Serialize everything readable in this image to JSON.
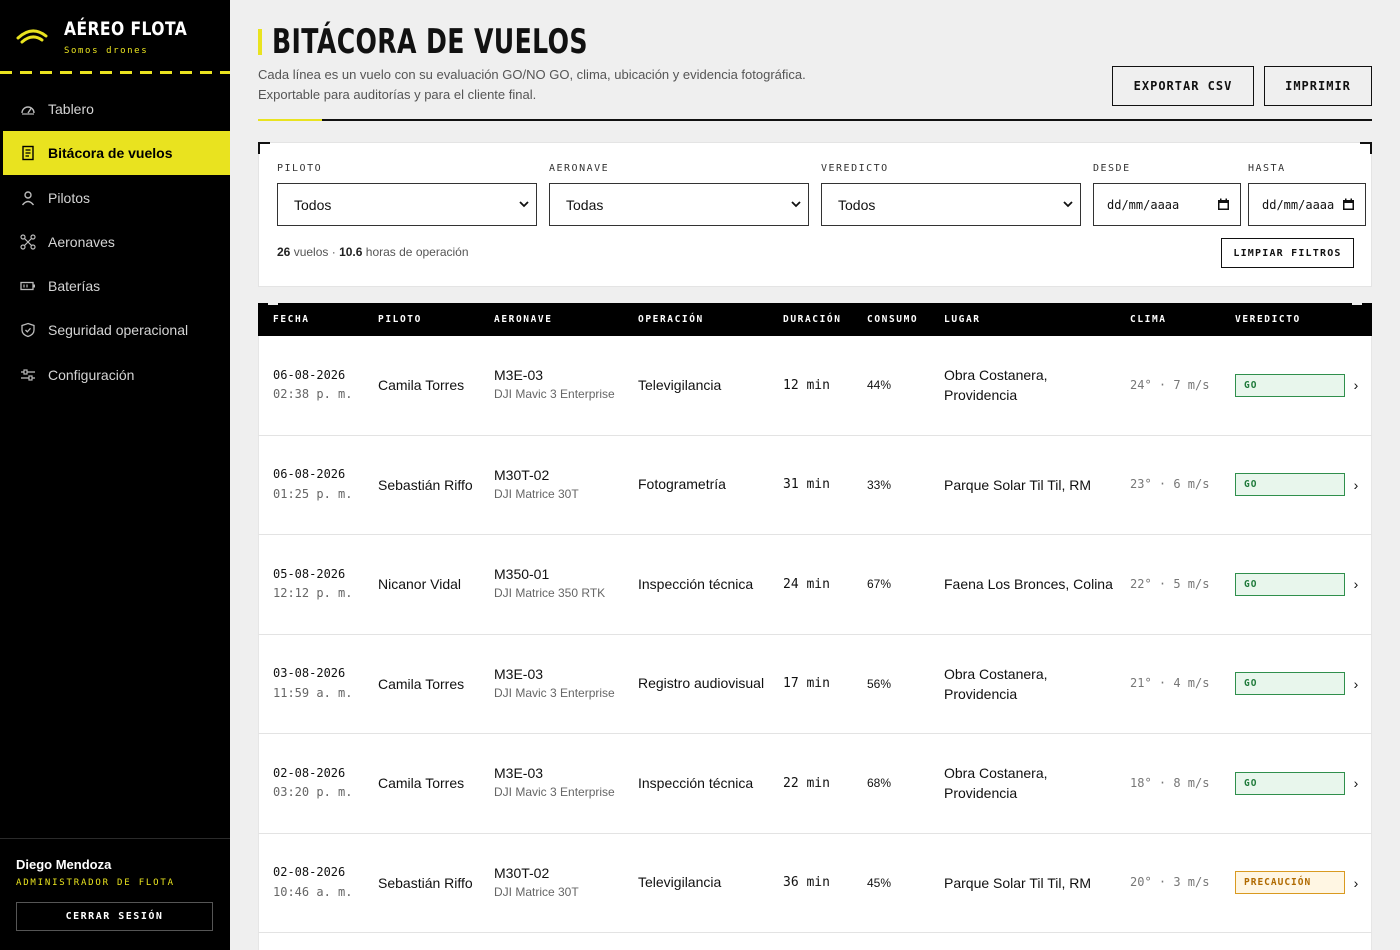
{
  "brand": {
    "name": "AÉREO FLOTA",
    "tagline": "Somos drones",
    "accent": "#e9e31f"
  },
  "nav": [
    {
      "label": "Tablero",
      "icon": "gauge-icon",
      "active": false
    },
    {
      "label": "Bitácora de vuelos",
      "icon": "document-icon",
      "active": true
    },
    {
      "label": "Pilotos",
      "icon": "user-icon",
      "active": false
    },
    {
      "label": "Aeronaves",
      "icon": "drone-icon",
      "active": false
    },
    {
      "label": "Baterías",
      "icon": "battery-icon",
      "active": false
    },
    {
      "label": "Seguridad operacional",
      "icon": "shield-icon",
      "active": false
    },
    {
      "label": "Configuración",
      "icon": "sliders-icon",
      "active": false
    }
  ],
  "user": {
    "name": "Diego Mendoza",
    "role": "ADMINISTRADOR DE FLOTA",
    "logout_label": "CERRAR SESIÓN"
  },
  "header": {
    "title": "BITÁCORA DE VUELOS",
    "subtitle_line1": "Cada línea es un vuelo con su evaluación GO/NO GO, clima, ubicación y evidencia fotográfica.",
    "subtitle_line2": "Exportable para auditorías y para el cliente final.",
    "export_label": "EXPORTAR CSV",
    "print_label": "IMPRIMIR"
  },
  "filters": {
    "pilot": {
      "label": "PILOTO",
      "value": "Todos"
    },
    "aircraft": {
      "label": "AERONAVE",
      "value": "Todas"
    },
    "verdict": {
      "label": "VEREDICTO",
      "value": "Todos"
    },
    "from": {
      "label": "DESDE",
      "value": "dd/mm/aaaa"
    },
    "to": {
      "label": "HASTA",
      "value": "dd/mm/aaaa"
    },
    "summary": {
      "flights": "26",
      "flights_suffix": "vuelos ·",
      "hours": "10.6",
      "hours_suffix": "horas de operación"
    },
    "clear_label": "LIMPIAR FILTROS"
  },
  "table": {
    "headers": {
      "date": "FECHA",
      "pilot": "PILOTO",
      "aircraft": "AERONAVE",
      "operation": "OPERACIÓN",
      "duration": "DURACIÓN",
      "consumption": "CONSUMO",
      "place": "LUGAR",
      "weather": "CLIMA",
      "verdict": "VEREDICTO"
    },
    "rows": [
      {
        "date": "06-08-2026",
        "time": "02:38 p. m.",
        "pilot": "Camila Torres",
        "code": "M3E-03",
        "model": "DJI Mavic 3 Enterprise",
        "operation": "Televigilancia",
        "duration": "12 min",
        "consumption": "44%",
        "place": "Obra Costanera, Providencia",
        "weather": "24° · 7 m/s",
        "verdict": "GO",
        "verdict_type": "go"
      },
      {
        "date": "06-08-2026",
        "time": "01:25 p. m.",
        "pilot": "Sebastián Riffo",
        "code": "M30T-02",
        "model": "DJI Matrice 30T",
        "operation": "Fotogrametría",
        "duration": "31 min",
        "consumption": "33%",
        "place": "Parque Solar Til Til, RM",
        "weather": "23° · 6 m/s",
        "verdict": "GO",
        "verdict_type": "go"
      },
      {
        "date": "05-08-2026",
        "time": "12:12 p. m.",
        "pilot": "Nicanor Vidal",
        "code": "M350-01",
        "model": "DJI Matrice 350 RTK",
        "operation": "Inspección técnica",
        "duration": "24 min",
        "consumption": "67%",
        "place": "Faena Los Bronces, Colina",
        "weather": "22° · 5 m/s",
        "verdict": "GO",
        "verdict_type": "go"
      },
      {
        "date": "03-08-2026",
        "time": "11:59 a. m.",
        "pilot": "Camila Torres",
        "code": "M3E-03",
        "model": "DJI Mavic 3 Enterprise",
        "operation": "Registro audiovisual",
        "duration": "17 min",
        "consumption": "56%",
        "place": "Obra Costanera, Providencia",
        "weather": "21° · 4 m/s",
        "verdict": "GO",
        "verdict_type": "go"
      },
      {
        "date": "02-08-2026",
        "time": "03:20 p. m.",
        "pilot": "Camila Torres",
        "code": "M3E-03",
        "model": "DJI Mavic 3 Enterprise",
        "operation": "Inspección técnica",
        "duration": "22 min",
        "consumption": "68%",
        "place": "Obra Costanera, Providencia",
        "weather": "18° · 8 m/s",
        "verdict": "GO",
        "verdict_type": "go"
      },
      {
        "date": "02-08-2026",
        "time": "10:46 a. m.",
        "pilot": "Sebastián Riffo",
        "code": "M30T-02",
        "model": "DJI Matrice 30T",
        "operation": "Televigilancia",
        "duration": "36 min",
        "consumption": "45%",
        "place": "Parque Solar Til Til, RM",
        "weather": "20° · 3 m/s",
        "verdict": "PRECAUCIÓN",
        "verdict_type": "warn"
      }
    ]
  }
}
